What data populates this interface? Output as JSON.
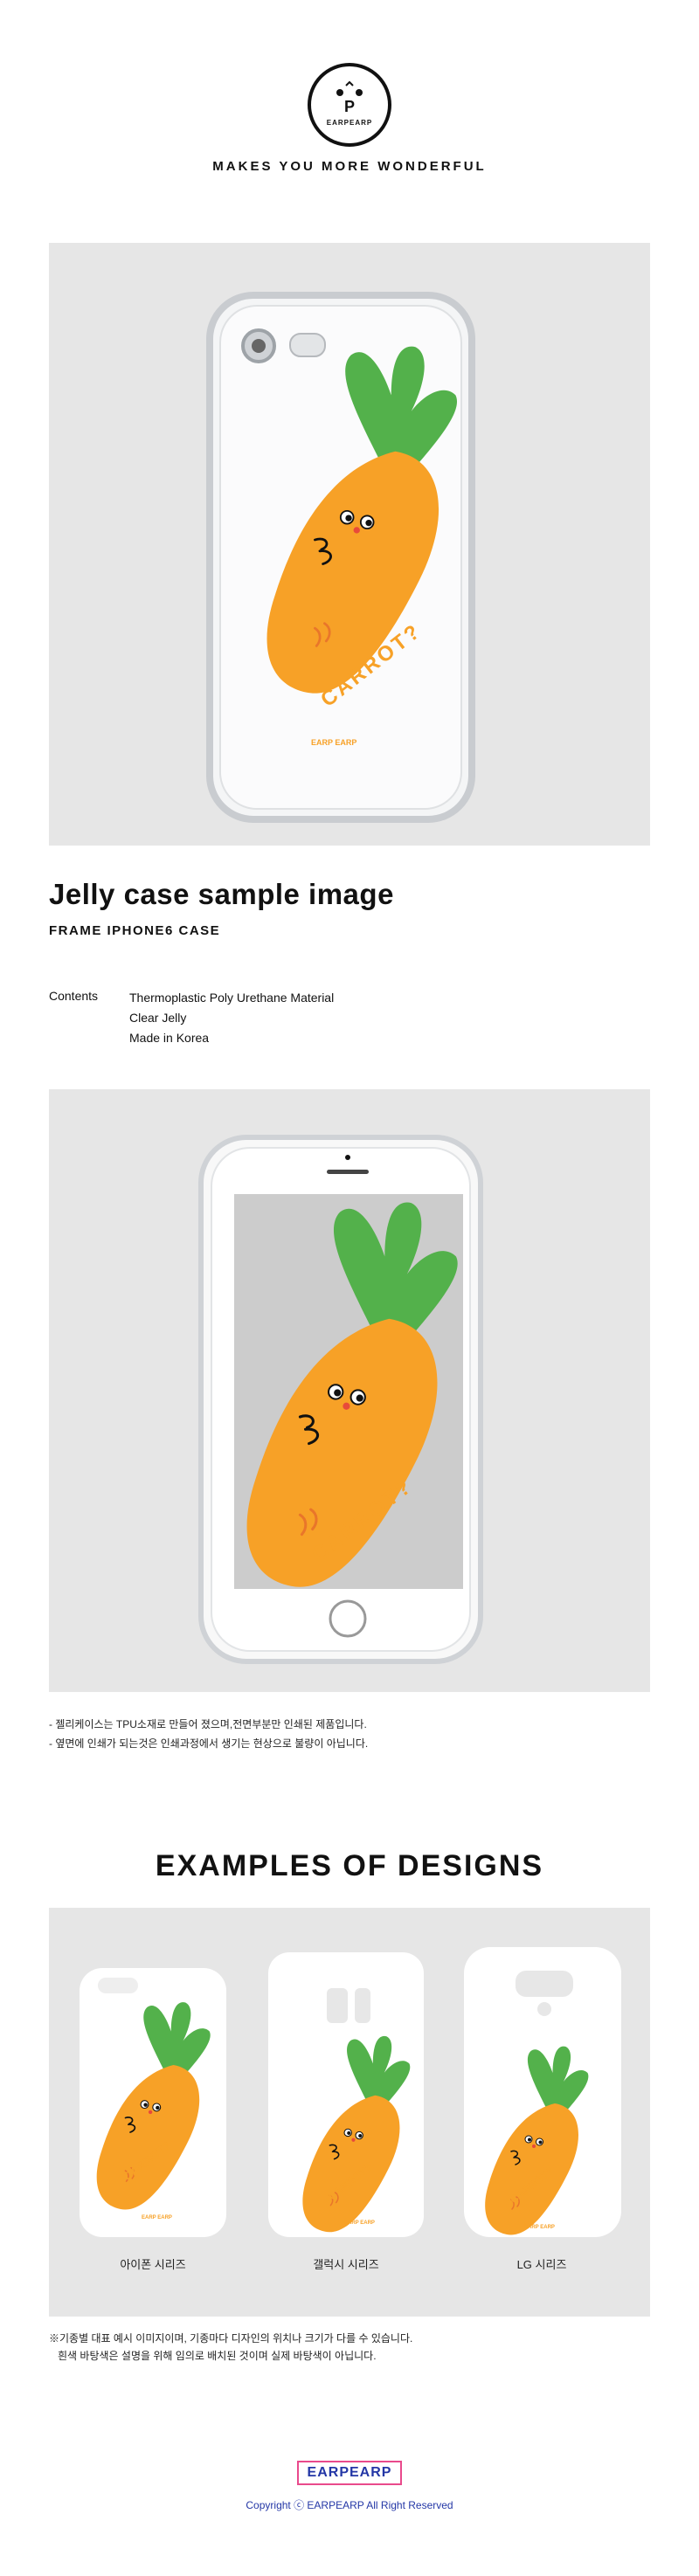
{
  "brand": {
    "logo_text": "EARPEARP",
    "logo_letter": "P",
    "tagline": "MAKES YOU MORE WONDERFUL"
  },
  "artwork": {
    "caption": "CARROT?",
    "case_mark": "EARP EARP"
  },
  "product": {
    "title": "Jelly case sample image",
    "subtitle": "FRAME IPHONE6 CASE",
    "contents_label": "Contents",
    "contents": [
      "Thermoplastic Poly Urethane Material",
      "Clear Jelly",
      "Made in Korea"
    ]
  },
  "notes": [
    "- 젤리케이스는 TPU소재로 만들어 졌으며,전면부분만 인쇄된 제품입니다.",
    "- 옆면에 인쇄가 되는것은 인쇄과정에서 생기는 현상으로 불량이 아닙니다."
  ],
  "examples": {
    "title": "EXAMPLES OF DESIGNS",
    "items": [
      {
        "label": "아이폰 시리즈"
      },
      {
        "label": "갤럭시 시리즈"
      },
      {
        "label": "LG 시리즈"
      }
    ],
    "notes": [
      "※기종별 대표 예시 이미지이며, 기종마다 디자인의 위치나 크기가 다를 수 있습니다.",
      "   흰색 바탕색은 설명을 위해 임의로 배치된 것이며 실제 바탕색이 아닙니다."
    ]
  },
  "footer": {
    "logo": "EARPEARP",
    "copyright": "Copyright ⓒ EARPEARP All Right Reserved"
  },
  "colors": {
    "carrot": "#f7a127",
    "leaf": "#53b14b",
    "panel": "#e6e6e6",
    "brand_blue": "#2437a6",
    "brand_pink": "#e94a8c"
  }
}
